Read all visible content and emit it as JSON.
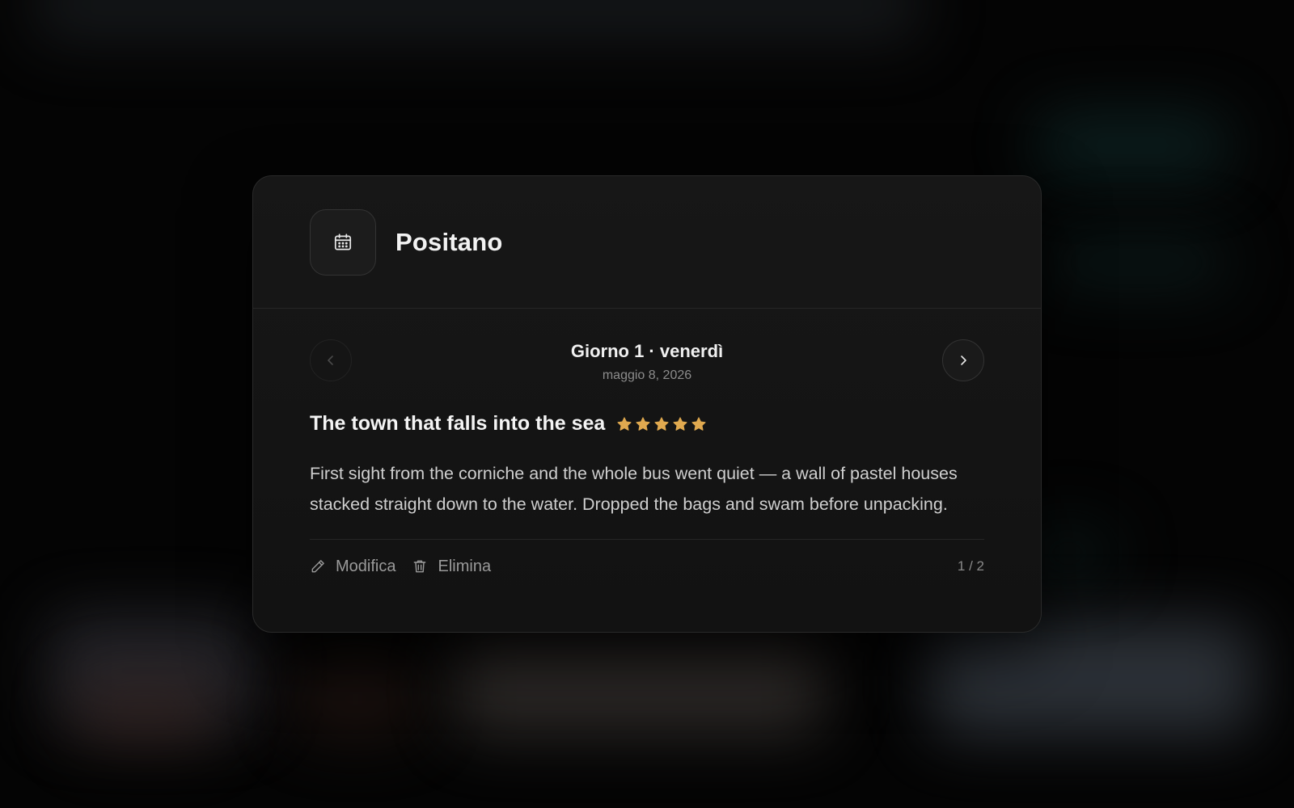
{
  "header": {
    "title": "Positano",
    "icon": "calendar-icon"
  },
  "day": {
    "title": "Giorno 1 · venerdì",
    "date": "maggio 8, 2026",
    "prev_icon": "chevron-left-icon",
    "next_icon": "chevron-right-icon"
  },
  "entry": {
    "title": "The town that falls into the sea",
    "rating": 5,
    "rating_max": 5,
    "star_color": "#e0a94f",
    "text": "First sight from the corniche and the whole bus went quiet — a wall of pastel houses stacked straight down to the water. Dropped the bags and swam before unpacking."
  },
  "footer": {
    "edit_label": "Modifica",
    "delete_label": "Elimina",
    "pager": "1 / 2"
  }
}
